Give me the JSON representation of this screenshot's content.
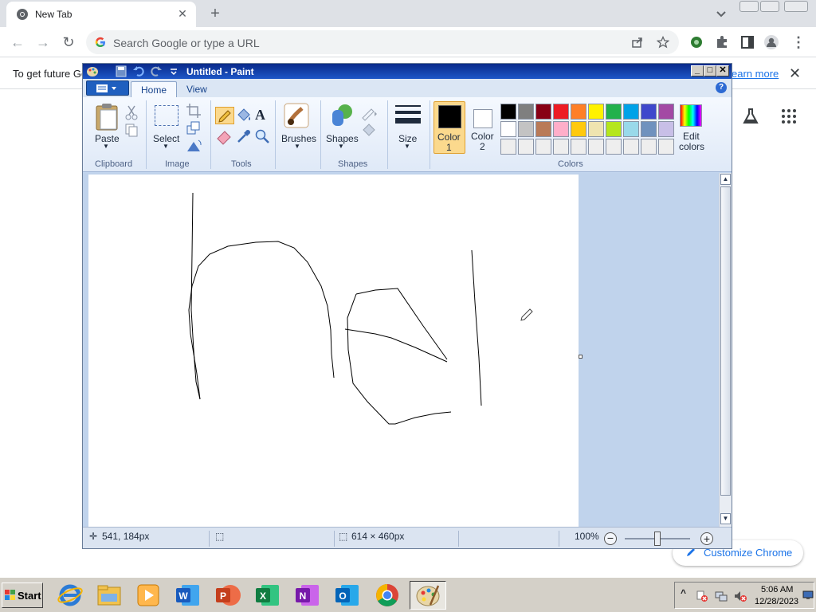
{
  "browser": {
    "tab_title": "New Tab",
    "omnibox_placeholder": "Search Google or type a URL",
    "infobar_text": "To get future Go",
    "infobar_link": "earn more",
    "customize_label": "Customize Chrome"
  },
  "paint": {
    "window_title": "Untitled - Paint",
    "tabs": [
      "Home",
      "View"
    ],
    "groups": {
      "clipboard": "Clipboard",
      "image": "Image",
      "tools": "Tools",
      "shapes": "Shapes",
      "colors": "Colors"
    },
    "buttons": {
      "paste": "Paste",
      "select": "Select",
      "brushes": "Brushes",
      "shapes": "Shapes",
      "size": "Size",
      "color1_a": "Color",
      "color1_b": "1",
      "color2_a": "Color",
      "color2_b": "2",
      "edit_colors_a": "Edit",
      "edit_colors_b": "colors"
    },
    "palette_row1": [
      "#000000",
      "#7f7f7f",
      "#880015",
      "#ed1c24",
      "#ff7f27",
      "#fff200",
      "#22b14c",
      "#00a2e8",
      "#3f48cc",
      "#a349a4"
    ],
    "palette_row2": [
      "#ffffff",
      "#c3c3c3",
      "#b97a57",
      "#ffaec9",
      "#ffc90e",
      "#efe4b0",
      "#b5e61d",
      "#99d9ea",
      "#7092be",
      "#c8bfe7"
    ],
    "palette_row3": [
      "#eeeeee",
      "#eeeeee",
      "#eeeeee",
      "#eeeeee",
      "#eeeeee",
      "#eeeeee",
      "#eeeeee",
      "#eeeeee",
      "#eeeeee",
      "#eeeeee"
    ],
    "color1": "#000000",
    "color2": "#ffffff",
    "status": {
      "cursor_pos": "541, 184px",
      "canvas_size": "614 × 460px",
      "zoom": "100%"
    }
  },
  "taskbar": {
    "start_label": "Start",
    "time": "5:06 AM",
    "date": "12/28/2023"
  }
}
